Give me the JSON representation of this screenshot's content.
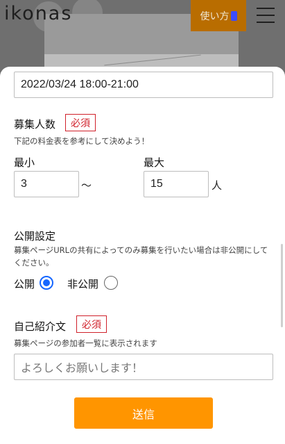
{
  "header": {
    "logo_text": "ikonas",
    "howto_label": "使い方",
    "howto_icon": "phone-icon",
    "menu_icon": "hamburger-menu-icon"
  },
  "form": {
    "datetime_value": "2022/03/24 18:00-21:00",
    "capacity": {
      "title": "募集人数",
      "required_label": "必須",
      "help": "下記の料金表を参考にして決めよう！",
      "min_label": "最小",
      "min_value": "3",
      "range_separator": "〜",
      "max_label": "最大",
      "max_value": "15",
      "unit": "人"
    },
    "visibility": {
      "title": "公開設定",
      "help": "募集ページURLの共有によってのみ募集を行いたい場合は非公開にしてください。",
      "public_label": "公開",
      "private_label": "非公開",
      "selected": "公開"
    },
    "intro": {
      "title": "自己紹介文",
      "required_label": "必須",
      "help": "募集ページの参加者一覧に表示されます",
      "placeholder": "よろしくお願いします！"
    },
    "submit_label": "送信"
  },
  "colors": {
    "accent": "#ff9500",
    "required": "#d0202a",
    "radio_selected": "#1566ff"
  }
}
